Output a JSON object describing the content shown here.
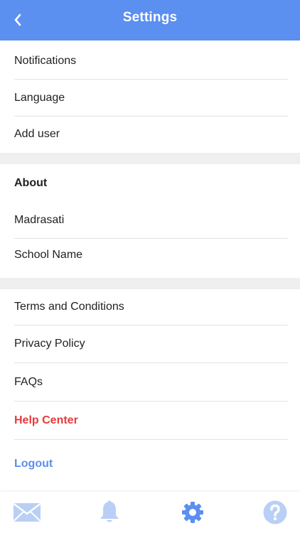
{
  "header": {
    "title": "Settings",
    "back_icon": "chevron-left-icon"
  },
  "group1": {
    "items": [
      "Notifications",
      "Language",
      "Add user"
    ]
  },
  "about": {
    "heading": "About",
    "items": [
      "Madrasati",
      "School Name"
    ]
  },
  "group3": {
    "items": [
      "Terms and Conditions",
      "Privacy Policy",
      "FAQs"
    ],
    "help_center": "Help Center",
    "logout": "Logout"
  },
  "tabbar": {
    "tabs": [
      {
        "icon": "mail-icon"
      },
      {
        "icon": "bell-icon"
      },
      {
        "icon": "gear-icon",
        "active": true
      },
      {
        "icon": "help-icon"
      }
    ]
  },
  "colors": {
    "accent": "#5b8ff0",
    "danger": "#e53b3b",
    "inactive_icon": "#b9cff5"
  }
}
